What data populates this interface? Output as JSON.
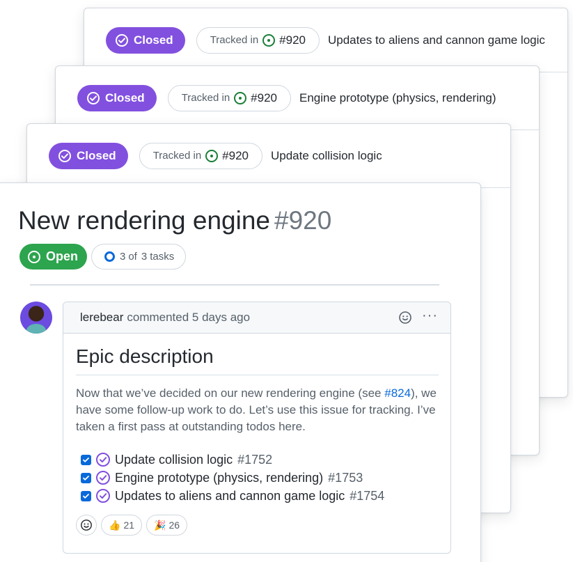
{
  "related": [
    {
      "status": "Closed",
      "tracked_label": "Tracked in",
      "tracked_ref": "#920",
      "title": "Updates to aliens and cannon game logic"
    },
    {
      "status": "Closed",
      "tracked_label": "Tracked in",
      "tracked_ref": "#920",
      "title": "Engine prototype (physics, rendering)"
    },
    {
      "status": "Closed",
      "tracked_label": "Tracked in",
      "tracked_ref": "#920",
      "title": "Update collision logic"
    }
  ],
  "issue": {
    "title": "New rendering engine",
    "number": "#920",
    "status": "Open",
    "tasks_done": "3",
    "tasks_of": "of",
    "tasks_total": "3",
    "tasks_word": "tasks"
  },
  "comment": {
    "author": "lerebear",
    "meta": "commented 5 days ago",
    "heading": "Epic description",
    "body_before_link": "Now that we’ve decided on our new rendering engine (see ",
    "body_link": "#824",
    "body_after_link": "), we have some follow-up work to do. Let’s use this issue for tracking. I’ve taken a first pass at outstanding todos here.",
    "tasks": [
      {
        "title": "Update collision logic",
        "ref": "#1752",
        "checked": true
      },
      {
        "title": "Engine prototype (physics, rendering)",
        "ref": "#1753",
        "checked": true
      },
      {
        "title": "Updates to aliens and cannon game logic",
        "ref": "#1754",
        "checked": true
      }
    ],
    "reactions": [
      {
        "emoji": "👍",
        "count": "21"
      },
      {
        "emoji": "🎉",
        "count": "26"
      }
    ]
  },
  "colors": {
    "closed": "#8250df",
    "open": "#2da44e",
    "link": "#0969da",
    "tracked_icon": "#1a7f37"
  },
  "icons": {
    "closed": "check-circle-icon",
    "open": "issue-opened-icon",
    "tracked": "issue-opened-icon",
    "task": "issue-closed-icon",
    "progress": "progress-ring-icon",
    "emoji": "smiley-icon",
    "more": "kebab-horizontal-icon"
  }
}
